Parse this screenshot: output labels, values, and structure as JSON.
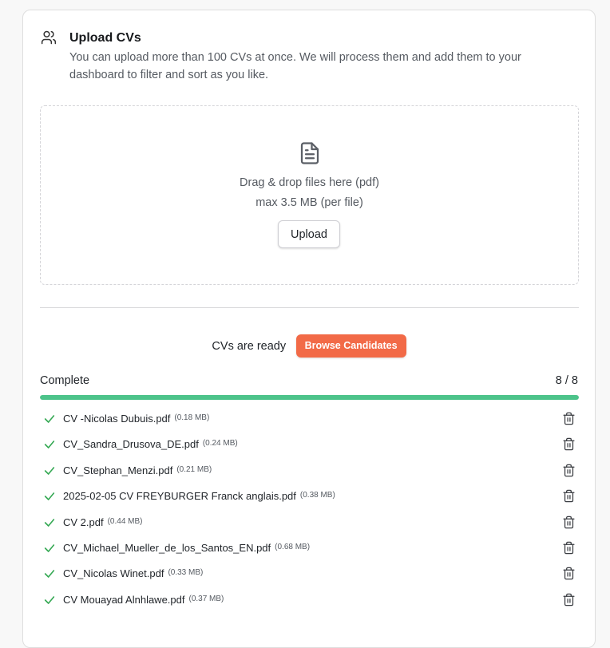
{
  "header": {
    "icon": "users-icon",
    "title": "Upload CVs",
    "description": "You can upload more than 100 CVs at once. We will process them and add them to your dashboard to filter and sort as you like."
  },
  "dropzone": {
    "icon": "document-icon",
    "line1": "Drag & drop files here (pdf)",
    "line2": "max 3.5 MB (per file)",
    "upload_label": "Upload"
  },
  "ready": {
    "text": "CVs are ready",
    "browse_label": "Browse Candidates",
    "browse_color": "#f26a47"
  },
  "progress": {
    "label": "Complete",
    "count": "8 / 8",
    "fraction": 1.0,
    "color": "#4cc38a"
  },
  "files": [
    {
      "name": "CV -Nicolas Dubuis.pdf",
      "size": "(0.18 MB)"
    },
    {
      "name": "CV_Sandra_Drusova_DE.pdf",
      "size": "(0.24 MB)"
    },
    {
      "name": "CV_Stephan_Menzi.pdf",
      "size": "(0.21 MB)"
    },
    {
      "name": "2025-02-05 CV FREYBURGER Franck anglais.pdf",
      "size": "(0.38 MB)"
    },
    {
      "name": "CV 2.pdf",
      "size": "(0.44 MB)"
    },
    {
      "name": "CV_Michael_Mueller_de_los_Santos_EN.pdf",
      "size": "(0.68 MB)"
    },
    {
      "name": "CV_Nicolas Winet.pdf",
      "size": "(0.33 MB)"
    },
    {
      "name": "CV Mouayad Alnhlawe.pdf",
      "size": "(0.37 MB)"
    }
  ]
}
